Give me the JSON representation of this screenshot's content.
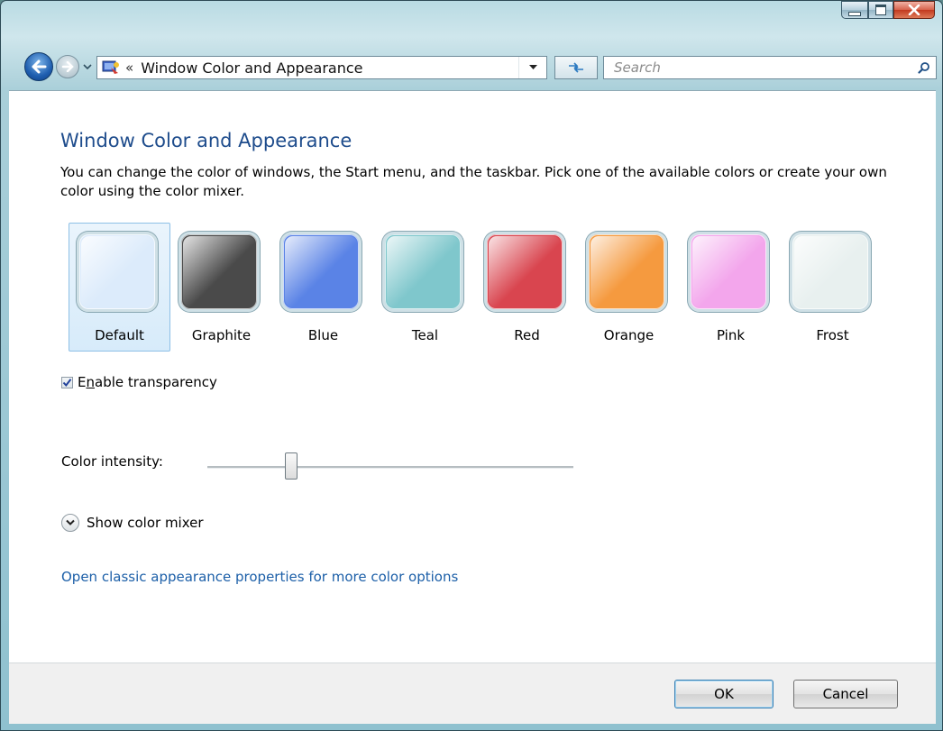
{
  "window": {
    "address_path": "Window Color and Appearance",
    "address_chevron": "«",
    "search_placeholder": "Search"
  },
  "main": {
    "title": "Window Color and Appearance",
    "description": "You can change the color of windows, the Start menu, and the taskbar. Pick one of the available colors or create your own color using the color mixer.",
    "swatches": [
      {
        "label": "Default",
        "color": "#dcebfb",
        "selected": true
      },
      {
        "label": "Graphite",
        "color": "#4a4a4a"
      },
      {
        "label": "Blue",
        "color": "#5a83e6"
      },
      {
        "label": "Teal",
        "color": "#7fc7cc"
      },
      {
        "label": "Red",
        "color": "#d9454f"
      },
      {
        "label": "Orange",
        "color": "#f59a3f"
      },
      {
        "label": "Pink",
        "color": "#f3a6ec"
      },
      {
        "label": "Frost",
        "color": "#e8f0ef"
      }
    ],
    "transparency": {
      "label": "Enable transparency",
      "mnemonic": "n",
      "checked": true
    },
    "intensity": {
      "label": "Color intensity:",
      "value": 0.23
    },
    "mixer_label": "Show color mixer",
    "classic_link": "Open classic appearance properties for more color options"
  },
  "footer": {
    "ok_label": "OK",
    "cancel_label": "Cancel"
  },
  "colors": {
    "link": "#1c5fa8",
    "title": "#1e4c8c",
    "selection_border": "#8ec0e6"
  }
}
